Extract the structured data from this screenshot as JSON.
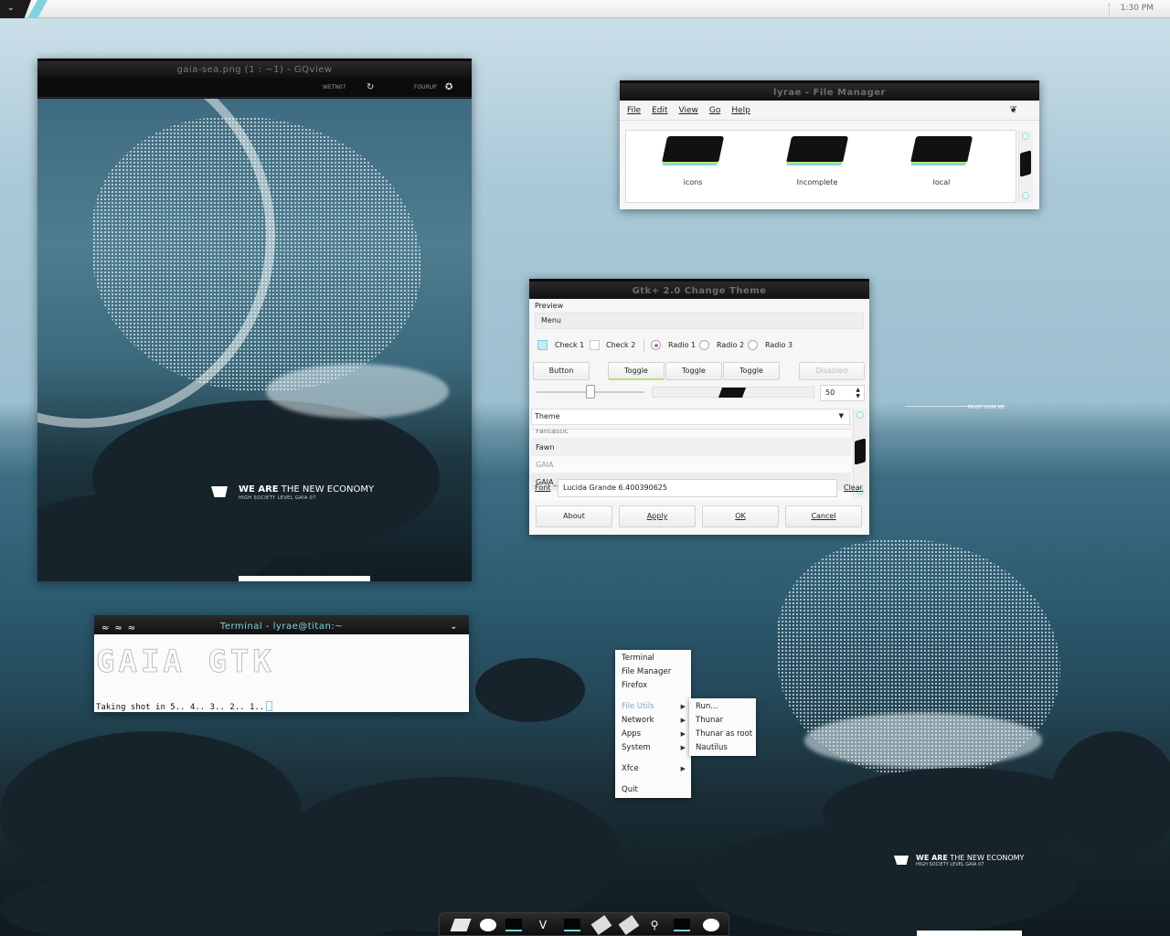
{
  "panel": {
    "menu_glyph": "⌄",
    "clock": "1:30 PM"
  },
  "gqview": {
    "title": "gaia-sea.png (1 : ~1) - GQview",
    "toolbar_left": "WETN07",
    "toolbar_right": "FOURUP",
    "slogan_bold": "WE ARE",
    "slogan_rest": " THE NEW ECONOMY",
    "slogan_small": "HIGH SOCIETY LEVEL GAIA 07"
  },
  "filemgr": {
    "title": "lyrae - File Manager",
    "menu": [
      "File",
      "Edit",
      "View",
      "Go",
      "Help"
    ],
    "items": [
      "icons",
      "Incomplete",
      "local"
    ]
  },
  "gtk": {
    "title": "Gtk+ 2.0 Change Theme",
    "preview_label": "Preview",
    "menu_label": "Menu",
    "check1": "Check 1",
    "check2": "Check 2",
    "radio1": "Radio 1",
    "radio2": "Radio 2",
    "radio3": "Radio 3",
    "button": "Button",
    "toggle": "Toggle",
    "disabled": "Disabled",
    "spin_value": "50",
    "theme_label": "Theme",
    "themes": [
      "Fantastic",
      "Fawn",
      "GAIA",
      "GAIA_ECO"
    ],
    "font_label": "Font",
    "font_value": "Lucida Grande 6.400390625",
    "clear": "Clear",
    "about": "About",
    "apply": "Apply",
    "ok": "OK",
    "cancel": "Cancel"
  },
  "terminal": {
    "title": "Terminal - lyrae@titan:~",
    "ascii": "GAIA GTK",
    "line": "Taking shot in 5.. 4.. 3.. 2.. 1.."
  },
  "rootmenu": {
    "items": [
      "Terminal",
      "File Manager",
      "Firefox",
      "File Utils",
      "Network",
      "Apps",
      "System",
      "Xfce",
      "Quit"
    ],
    "submenu": [
      "Run...",
      "Thunar",
      "Thunar as root",
      "Nautilus"
    ]
  },
  "desktop": {
    "slogan_bold": "WE ARE",
    "slogan_rest": " THE NEW ECONOMY",
    "slogan_small": "HIGH SOCIETY LEVEL GAIA 07",
    "trust": "TRUST YOUR ME"
  },
  "colors": {
    "accent": "#7fd3dc",
    "accent2": "#b7e27c",
    "titlebar": "#111111"
  }
}
